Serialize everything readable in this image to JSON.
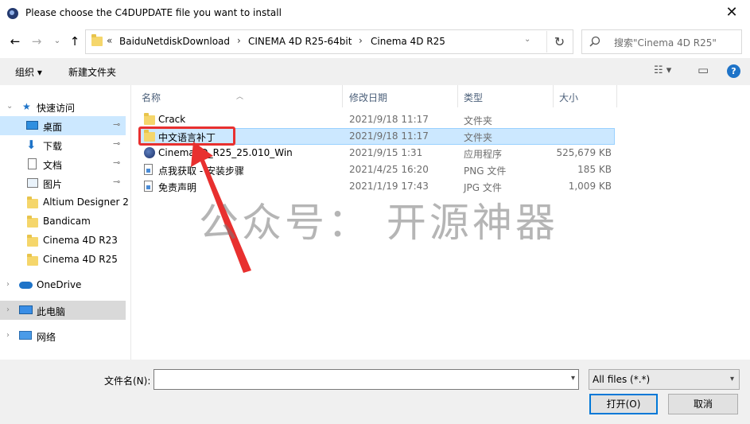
{
  "window": {
    "title": "Please choose the C4DUPDATE file you want to install",
    "close_glyph": "✕"
  },
  "nav_buttons": {
    "back": "←",
    "forward": "→",
    "recent": "⌄",
    "up": "↑"
  },
  "address": {
    "overflow": "«",
    "crumbs": [
      "BaiduNetdiskDownload",
      "CINEMA 4D R25-64bit",
      "Cinema 4D R25"
    ],
    "separator": "›",
    "refresh": "↻"
  },
  "search": {
    "placeholder": "搜索\"Cinema 4D R25\""
  },
  "toolbar": {
    "organize": "组织 ▾",
    "new_folder": "新建文件夹",
    "view_icon": "☷ ▾",
    "pane_icon": "▭",
    "help": "?"
  },
  "sidebar": {
    "quick_access": "快速访问",
    "items": [
      {
        "label": "桌面",
        "pinned": true,
        "icon": "desktop-icon"
      },
      {
        "label": "下载",
        "pinned": true,
        "icon": "download-icon"
      },
      {
        "label": "文档",
        "pinned": true,
        "icon": "document-icon"
      },
      {
        "label": "图片",
        "pinned": true,
        "icon": "picture-icon"
      },
      {
        "label": "Altium Designer 2",
        "pinned": false,
        "icon": "folder-icon"
      },
      {
        "label": "Bandicam",
        "pinned": false,
        "icon": "folder-icon"
      },
      {
        "label": "Cinema 4D R23",
        "pinned": false,
        "icon": "folder-icon"
      },
      {
        "label": "Cinema 4D R25",
        "pinned": false,
        "icon": "folder-icon"
      }
    ],
    "pin_glyph": "📌",
    "onedrive": "OneDrive",
    "this_pc": "此电脑",
    "network": "网络"
  },
  "columns": {
    "name": "名称",
    "date": "修改日期",
    "type": "类型",
    "size": "大小"
  },
  "files": [
    {
      "name": "Crack",
      "date": "2021/9/18 11:17",
      "type": "文件夹",
      "size": "",
      "icon": "folder-icon"
    },
    {
      "name": "中文语言补丁",
      "date": "2021/9/18 11:17",
      "type": "文件夹",
      "size": "",
      "icon": "folder-icon",
      "selected": true
    },
    {
      "name": "Cinema4D_R25_25.010_Win",
      "date": "2021/9/15 1:31",
      "type": "应用程序",
      "size": "525,679 KB",
      "icon": "cinema4d-app-icon"
    },
    {
      "name": "点我获取 - 安装步骤",
      "date": "2021/4/25 16:20",
      "type": "PNG 文件",
      "size": "185 KB",
      "icon": "image-file-icon"
    },
    {
      "name": "免责声明",
      "date": "2021/1/19 17:43",
      "type": "JPG 文件",
      "size": "1,009 KB",
      "icon": "image-file-icon"
    }
  ],
  "watermark": "公众号： 开源神器",
  "footer": {
    "filename_label": "文件名(N):",
    "filename_value": "",
    "filter": "All files (*.*)",
    "open": "打开(O)",
    "cancel": "取消"
  },
  "colors": {
    "selection": "#cce8ff",
    "annotation_red": "#e8302f",
    "accent": "#0078d7"
  }
}
